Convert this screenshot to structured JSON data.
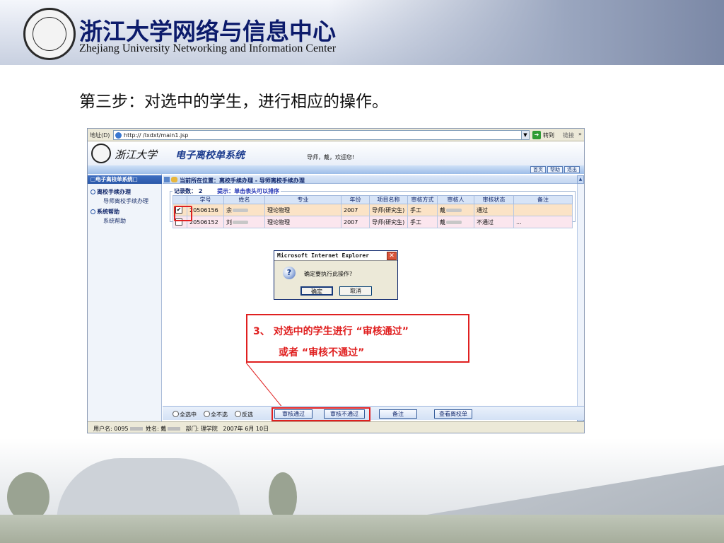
{
  "slide": {
    "org_cn": "浙江大学网络与信息中心",
    "org_en": "Zhejiang University Networking and Information Center",
    "step_title": "第三步：对选中的学生，进行相应的操作。"
  },
  "browser": {
    "address_label": "地址(D)",
    "url": "http://                  /lxdxt/main1.jsp",
    "go_label": "转到",
    "links_label": "链接",
    "more": "»"
  },
  "app": {
    "school_name": "浙江大学",
    "system_title": "电子离校单系统",
    "greeting": "导师，戴，欢迎您!",
    "nav_buttons": [
      "首页",
      "帮助",
      "退出"
    ]
  },
  "sidebar": {
    "header": "□电子离校单系统□",
    "groups": [
      {
        "label": "离校手续办理",
        "items": [
          "导师离校手续办理"
        ]
      },
      {
        "label": "系统帮助",
        "items": [
          "系统帮助"
        ]
      }
    ]
  },
  "content": {
    "location": "当前所在位置：离校手续办理 - 导师离校手续办理",
    "record_count_label": "记录数：",
    "record_count": "2",
    "hint": "提示：单击表头可以排序",
    "columns": [
      "",
      "学号",
      "姓名",
      "专业",
      "年份",
      "项目名称",
      "审核方式",
      "审核人",
      "审核状态",
      "备注"
    ],
    "rows": [
      {
        "checked": "✔",
        "id": "20506156",
        "name": "余",
        "major": "理论物理",
        "year": "2007",
        "project": "导师(研究生)",
        "method": "手工",
        "reviewer": "戴",
        "status": "通过",
        "note": ""
      },
      {
        "checked": "",
        "id": "20506152",
        "name": "刘",
        "major": "理论物理",
        "year": "2007",
        "project": "导师(研究生)",
        "method": "手工",
        "reviewer": "戴",
        "status": "不通过",
        "note": "..."
      }
    ]
  },
  "dialog": {
    "title": "Microsoft Internet Explorer",
    "message": "确定要执行此操作?",
    "ok_label": "确定",
    "cancel_label": "取消",
    "close_glyph": "✕",
    "icon_glyph": "?"
  },
  "annotation": {
    "line1": "3、  对选中的学生进行 “审核通过”",
    "line2": "或者 “审核不通过”",
    "color": "#e02020"
  },
  "bottom_bar": {
    "select_all": "全选中",
    "select_none": "全不选",
    "invert": "反选",
    "approve": "审核通过",
    "reject": "审核不通过",
    "note": "备注",
    "view_form": "查看离校单"
  },
  "statusbar": {
    "user_label": "用户名: 0095",
    "name_label": "姓名: 戴",
    "dept": "部门: 理学院",
    "date": "2007年 6月 10日"
  },
  "colors": {
    "brand_blue": "#0c1b6b",
    "highlight_red": "#e02020",
    "row_selected": "#fbe3c6",
    "row_other": "#fbe6ee"
  }
}
